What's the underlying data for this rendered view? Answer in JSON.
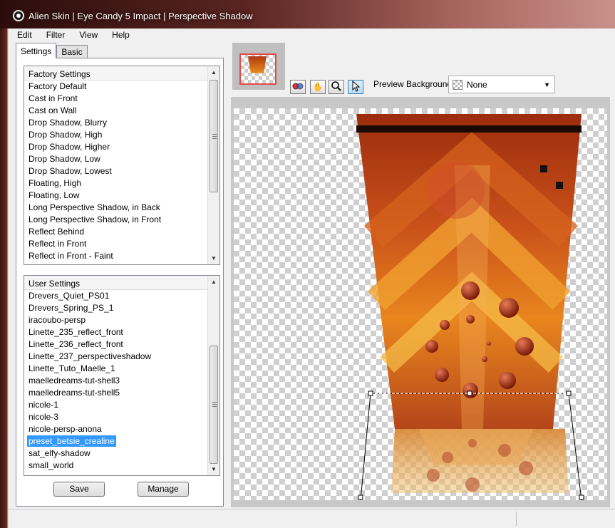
{
  "window": {
    "title": "Alien Skin | Eye Candy 5 Impact | Perspective Shadow"
  },
  "menu": [
    "Edit",
    "Filter",
    "View",
    "Help"
  ],
  "tabs": [
    {
      "label": "Settings",
      "active": true
    },
    {
      "label": "Basic",
      "active": false
    }
  ],
  "factory": {
    "header": "Factory Settings",
    "items": [
      "Factory Default",
      "Cast in Front",
      "Cast on Wall",
      "Drop Shadow, Blurry",
      "Drop Shadow, High",
      "Drop Shadow, Higher",
      "Drop Shadow, Low",
      "Drop Shadow, Lowest",
      "Floating, High",
      "Floating, Low",
      "Long Perspective Shadow, in Back",
      "Long Perspective Shadow, in Front",
      "Reflect Behind",
      "Reflect in Front",
      "Reflect in Front - Faint"
    ]
  },
  "user": {
    "header": "User Settings",
    "items": [
      "Drevers_Quiet_PS01",
      "Drevers_Spring_PS_1",
      "iracoubo-persp",
      "Linette_235_reflect_front",
      "Linette_236_reflect_front",
      "Linette_237_perspectiveshadow",
      "Linette_Tuto_Maelle_1",
      "maelledreams-tut-shell3",
      "maelledreams-tut-shell5",
      "nicole-1",
      "nicole-3",
      "nicole-persp-anona",
      "preset_betsie_crealine",
      "sat_elfy-shadow",
      "small_world"
    ],
    "selected": "preset_betsie_crealine"
  },
  "buttons": {
    "save": "Save",
    "manage": "Manage"
  },
  "preview": {
    "background_label": "Preview Background:",
    "background_value": "None",
    "tools": [
      "compare-icon",
      "hand-icon",
      "zoom-icon",
      "pointer-icon"
    ]
  },
  "colors": {
    "selection": "#3399ff",
    "accent_dark": "#8b2a10",
    "accent_orange": "#e8861e",
    "accent_gold": "#f6c04a"
  }
}
